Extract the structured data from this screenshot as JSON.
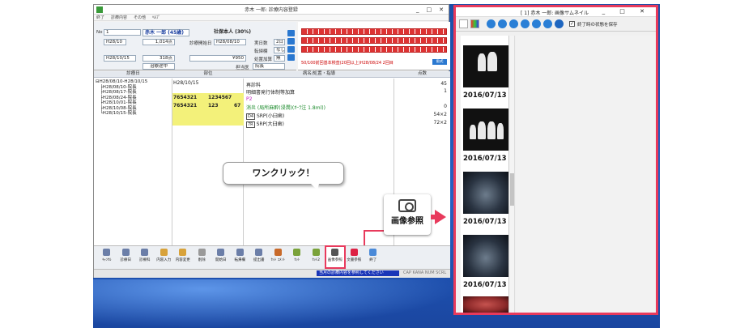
{
  "main_window": {
    "title": "赤木 一郎: 診療内容登録",
    "window_controls": [
      "_",
      "□",
      "✕"
    ],
    "menu": [
      "終了",
      "診療内容",
      "その他",
      "ﾍﾙﾌﾟ"
    ],
    "patient": {
      "no_label": "No",
      "no_value": "1",
      "name": "赤木 一郎 (45歳)",
      "insurance": "社保本人 (30%)",
      "start_label": "診療開始日",
      "start_value": "H28/08/10",
      "first_visit_label": "実日数",
      "first_visit_value": "2日",
      "transfer_label": "転帰欄",
      "transfer_value": "なし",
      "dept_label": "処置加算",
      "dept_value": "無",
      "date1": "H28/10",
      "points1": "1,014点",
      "date2": "H28/10/15",
      "points2": "318点",
      "amount": "¥950",
      "status": "治療途中",
      "staff_label": "担当医",
      "staff_value": "院長"
    },
    "chart_note": "50/100前回基本検査(20回以上)H28/08/24 2回目",
    "chart_button": "歯式",
    "columns": [
      "診療日",
      "部位",
      "病名/処置・指導",
      "点数"
    ],
    "tree": [
      "⊟H28/08/10-H28/10/15",
      "　├H28/08/10-院長",
      "　├H28/08/17-院長",
      "　├H28/08/24-院長",
      "　├H28/10/01-院長",
      "　├H28/10/08-院長",
      "　└H28/10/15-院長"
    ],
    "site_date": "H28/10/15",
    "codes": [
      {
        "c1": "7654321",
        "c2": "1234567"
      },
      {
        "c1": "7654321",
        "c2": "123",
        "c3": "67"
      }
    ],
    "rows": [
      {
        "text": "再診料",
        "points": "45"
      },
      {
        "text": "明細書発行体制等加算",
        "points": "1"
      },
      {
        "text": "P2",
        "points": ""
      },
      {
        "text": "消炎 (局所麻酔(浸潤)(ｵｰﾗ注 1.8ml))",
        "points": "0"
      },
      {
        "text": "SRP(小臼歯)",
        "tag": "D4",
        "points": "54×2"
      },
      {
        "text": "SRP(大臼歯)",
        "tag": "7R",
        "points": "72×2"
      }
    ],
    "callout": "ワンクリック！",
    "big_button_label": "画像参照",
    "toolbar": [
      "ｷｬﾝｾﾙ",
      "診療日",
      "診療科",
      "内容入力",
      "内容変更",
      "削除",
      "開始日",
      "転帰欄",
      "提出書",
      "ｾｯﾄ ｺﾒﾝﾄ",
      "ｾｯﾄ",
      "ｾｯﾄ2",
      "画像参照",
      "文書参照",
      "終了"
    ],
    "highlighted_tool": "画像参照",
    "status_message": "当月の診療内容を参照してください",
    "status_keys": "CAP KANA NUM SCRL"
  },
  "thumb_window": {
    "title": "[ 1] 赤木 一郎: 画像サムネイル",
    "controls": "_ □ ✕",
    "save_label": "終了時の状態を保存",
    "save_checked": "✓",
    "thumbnails": [
      {
        "date": "2016/07/13",
        "kind": "xray"
      },
      {
        "date": "2016/07/13",
        "kind": "xray"
      },
      {
        "date": "2016/07/13",
        "kind": "panorama"
      },
      {
        "date": "2016/07/13",
        "kind": "panorama"
      },
      {
        "date": "",
        "kind": "photo"
      }
    ]
  },
  "colors": {
    "accent": "#e83a5c",
    "desktop": "#2560c4",
    "highlight_yellow": "#f3f17a"
  }
}
